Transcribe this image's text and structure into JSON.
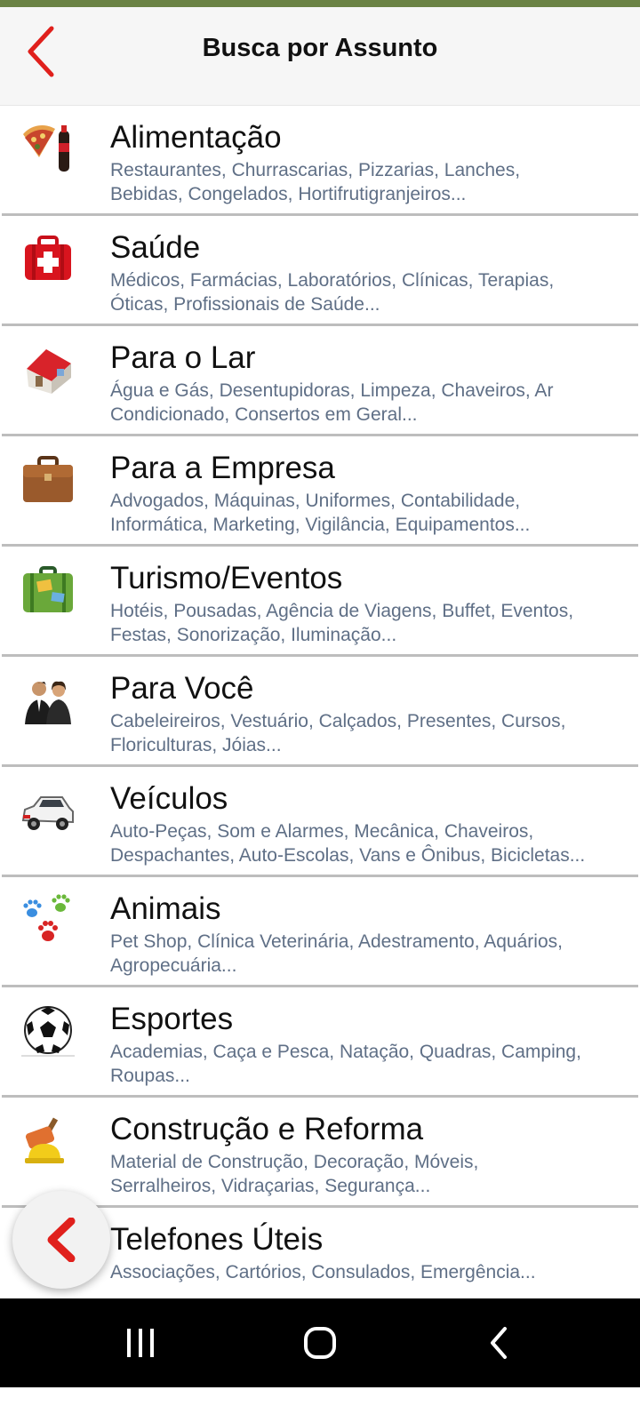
{
  "header": {
    "title": "Busca por Assunto"
  },
  "categories": [
    {
      "title": "Alimentação",
      "desc": "Restaurantes, Churrascarias, Pizzarias, Lanches,\nBebidas, Congelados, Hortifrutigranjeiros...",
      "icon": "food-icon"
    },
    {
      "title": "Saúde",
      "desc": "Médicos, Farmácias, Laboratórios, Clínicas, Terapias,\nÓticas, Profissionais de Saúde...",
      "icon": "first-aid-kit-icon"
    },
    {
      "title": "Para o Lar",
      "desc": "Água e Gás, Desentupidoras, Limpeza, Chaveiros, Ar\nCondicionado, Consertos em Geral...",
      "icon": "house-icon"
    },
    {
      "title": "Para a Empresa",
      "desc": "Advogados, Máquinas, Uniformes, Contabilidade,\nInformática, Marketing, Vigilância, Equipamentos...",
      "icon": "briefcase-icon"
    },
    {
      "title": "Turismo/Eventos",
      "desc": "Hotéis, Pousadas, Agência de Viagens, Buffet, Eventos,\nFestas, Sonorização, Iluminação...",
      "icon": "suitcase-icon"
    },
    {
      "title": "Para Você",
      "desc": "Cabeleireiros, Vestuário, Calçados, Presentes, Cursos,\nFloriculturas, Jóias...",
      "icon": "people-icon"
    },
    {
      "title": "Veículos",
      "desc": "Auto-Peças, Som e Alarmes, Mecânica, Chaveiros,\nDespachantes, Auto-Escolas, Vans e Ônibus, Bicicletas...",
      "icon": "car-icon"
    },
    {
      "title": "Animais",
      "desc": "Pet Shop, Clínica Veterinária, Adestramento, Aquários,\nAgropecuária...",
      "icon": "paws-icon"
    },
    {
      "title": "Esportes",
      "desc": "Academias, Caça e Pesca, Natação, Quadras, Camping,\nRoupas...",
      "icon": "soccer-ball-icon"
    },
    {
      "title": "Construção e Reforma",
      "desc": "Material de Construção, Decoração, Móveis,\nSerralheiros, Vidraçarias, Segurança...",
      "icon": "construction-icon"
    },
    {
      "title": "Telefones Úteis",
      "desc": "Associações, Cartórios, Consulados, Emergência...",
      "icon": "phone-icon"
    }
  ],
  "colors": {
    "accent_red": "#e0201c",
    "top_bar_green": "#6a8244",
    "description_text": "#5f6f86"
  }
}
